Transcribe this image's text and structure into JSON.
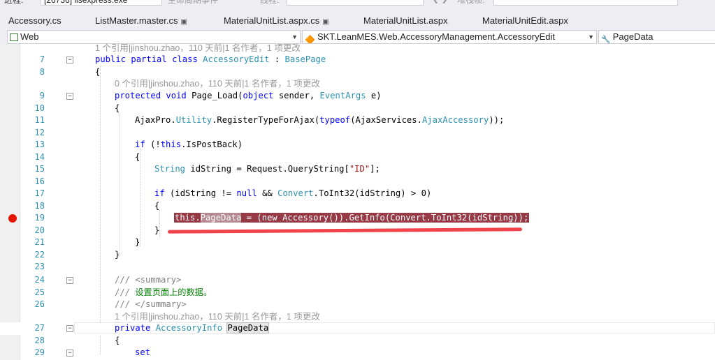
{
  "debugbar": {
    "process_label": "进程:",
    "process_value": "[26736] iisexpress.exe",
    "lifecycle_label": "生命周期事件",
    "thread_label": "线程:",
    "stack_label": "堆栈帧:"
  },
  "tabs": [
    {
      "label": "Accessory.cs",
      "pinned": false
    },
    {
      "label": "ListMaster.master.cs",
      "pinned": true
    },
    {
      "label": "MaterialUnitList.aspx.cs",
      "pinned": true
    },
    {
      "label": "MaterialUnitList.aspx",
      "pinned": false
    },
    {
      "label": "MaterialUnitEdit.aspx",
      "pinned": false
    }
  ],
  "nav": {
    "project": "Web",
    "type": "SKT.LeanMES.Web.AccessoryManagement.AccessoryEdit",
    "member": "PageData"
  },
  "codelens": {
    "one_ref": "1 个引用|jinshou.zhao，110 天前|1 名作者，1 项更改",
    "zero_ref": "0 个引用|jinshou.zhao，110 天前|1 名作者，1 项更改"
  },
  "lines": {
    "n7": "7",
    "n8": "8",
    "n9": "9",
    "n10": "10",
    "n11": "11",
    "n12": "12",
    "n13": "13",
    "n14": "14",
    "n15": "15",
    "n16": "16",
    "n17": "17",
    "n18": "18",
    "n19": "19",
    "n20": "20",
    "n21": "21",
    "n22": "22",
    "n23": "23",
    "n24": "24",
    "n25": "25",
    "n26": "26",
    "n27": "27",
    "n28": "28",
    "n29": "29"
  },
  "code": {
    "l7_public": "public",
    "l7_partial": "partial",
    "l7_class": "class",
    "l7_name": "AccessoryEdit",
    "l7_colon": " : ",
    "l7_base": "BasePage",
    "l8": "{",
    "l9_protected": "protected",
    "l9_void": "void",
    "l9_method": "Page_Load(",
    "l9_object": "object",
    "l9_sender": " sender, ",
    "l9_eventargs": "EventArgs",
    "l9_e": " e)",
    "l10": "{",
    "l11_a": "AjaxPro.",
    "l11_utility": "Utility",
    "l11_b": ".RegisterTypeForAjax(",
    "l11_typeof": "typeof",
    "l11_c": "(AjaxServices.",
    "l11_acc": "AjaxAccessory",
    "l11_d": "));",
    "l13_if": "if",
    "l13_a": " (!",
    "l13_this": "this",
    "l13_b": ".IsPostBack)",
    "l14": "{",
    "l15_string": "String",
    "l15_a": " idString = Request.QueryString[",
    "l15_id": "\"ID\"",
    "l15_b": "];",
    "l17_if": "if",
    "l17_a": " (idString != ",
    "l17_null": "null",
    "l17_b": " && ",
    "l17_convert": "Convert",
    "l17_c": ".ToInt32(idString) > 0)",
    "l18": "{",
    "l19_this": "this.",
    "l19_pagedata": "PageData",
    "l19_rest": " = (new Accessory()).GetInfo(Convert.ToInt32(idString));",
    "l20": "}",
    "l21": "}",
    "l22": "}",
    "l24_slashes": "/// ",
    "l24_tag": "<summary>",
    "l25_slashes": "/// ",
    "l25_text": "设置页面上的数据。",
    "l26_slashes": "/// ",
    "l26_tag": "</summary>",
    "l27_private": "private",
    "l27_type": "AccessoryInfo",
    "l27_name": "PageData",
    "l28": "{",
    "l29_set": "set"
  }
}
